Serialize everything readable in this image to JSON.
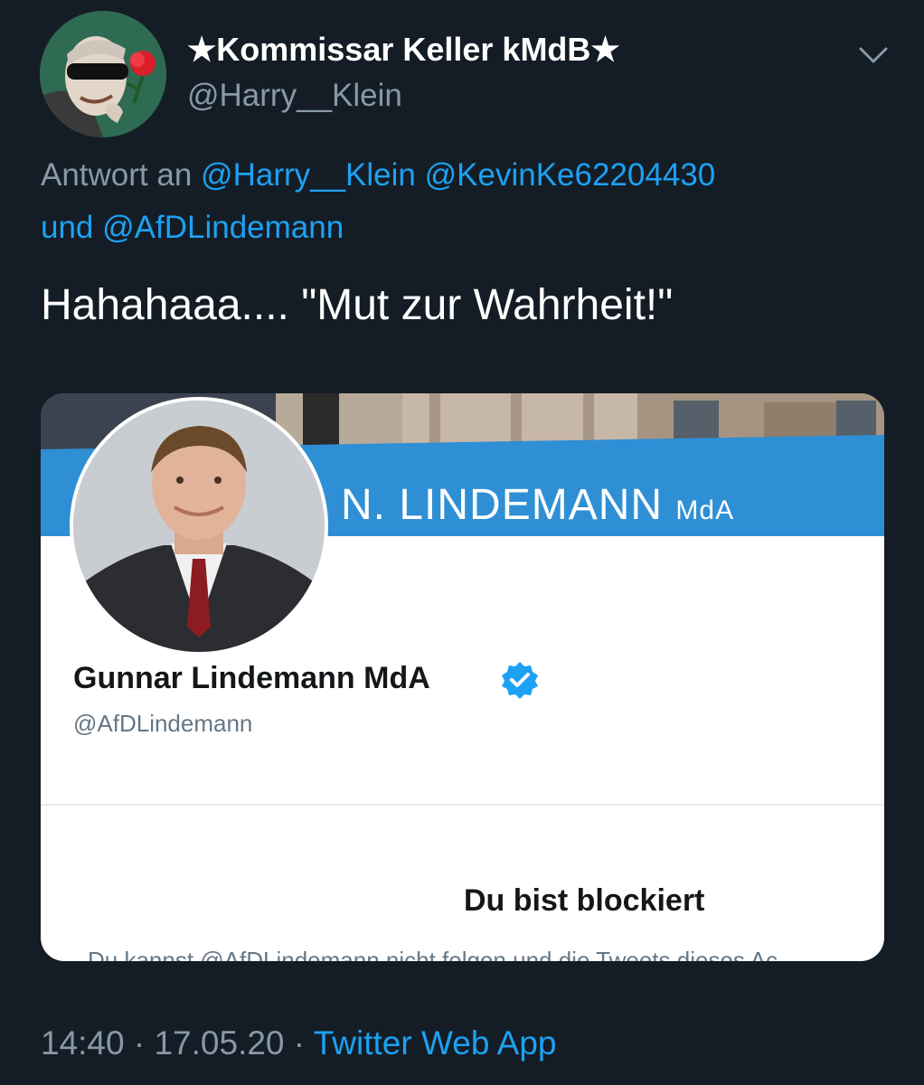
{
  "author": {
    "name": "★Kommissar Keller kMdB★",
    "handle": "@Harry__Klein"
  },
  "reply": {
    "prefix": "Antwort an",
    "mention1": "@Harry__Klein",
    "mention2": "@KevinKe62204430",
    "conjunction": "und",
    "mention3": "@AfDLindemann"
  },
  "tweet_text": "Hahahaaa.... \"Mut zur Wahrheit!\"",
  "embedded_profile": {
    "banner_title": "N. LINDEMANN",
    "banner_suffix": "MdA",
    "display_name": "Gunnar Lindemann MdA",
    "handle": "@AfDLindemann",
    "blocked_title": "Du bist blockiert",
    "blocked_text": "Du kannst @AfDLindemann nicht folgen und die Tweets dieses Ac"
  },
  "footer": {
    "time": "14:40",
    "separator": "·",
    "date": "17.05.20",
    "source": "Twitter Web App"
  },
  "colors": {
    "background": "#141d26",
    "link": "#1da1f2",
    "muted": "#8899a6",
    "banner_blue": "#2f8fd5"
  },
  "icons": [
    "chevron-down-icon",
    "verified-badge-icon"
  ]
}
